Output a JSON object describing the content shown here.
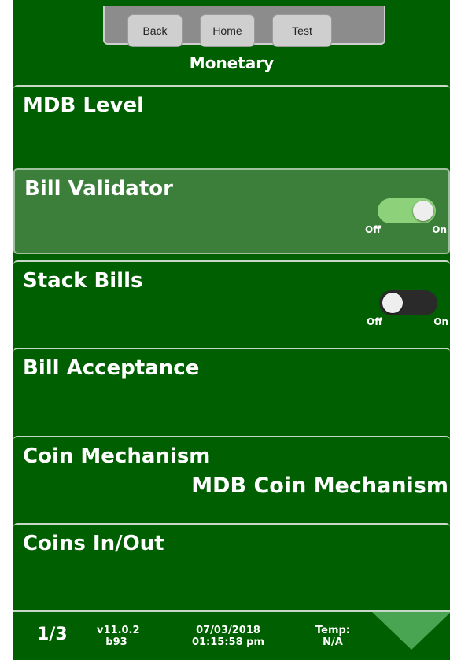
{
  "header": {
    "buttons": {
      "back": "Back",
      "home": "Home",
      "test": "Test"
    },
    "title": "Monetary"
  },
  "menu": {
    "items": [
      {
        "label": "MDB Level"
      },
      {
        "label": "Bill Validator",
        "toggle": {
          "state": "on",
          "off_label": "Off",
          "on_label": "On"
        }
      },
      {
        "label": "Stack Bills",
        "toggle": {
          "state": "off",
          "off_label": "Off",
          "on_label": "On"
        }
      },
      {
        "label": "Bill Acceptance"
      },
      {
        "label": "Coin Mechanism",
        "value": "MDB Coin Mechanism"
      },
      {
        "label": "Coins In/Out"
      }
    ]
  },
  "footer": {
    "page": "1/3",
    "version": "v11.0.2",
    "build": "b93",
    "date": "07/03/2018",
    "time": "01:15:58 pm",
    "temp_label": "Temp:",
    "temp_value": "N/A",
    "next_icon": "down-arrow-icon"
  },
  "colors": {
    "background": "#005f00",
    "selected": "#3b7f3b",
    "toggle_on": "#8dd17a",
    "toggle_off": "#2a2a2a",
    "arrow": "#4aa552"
  }
}
